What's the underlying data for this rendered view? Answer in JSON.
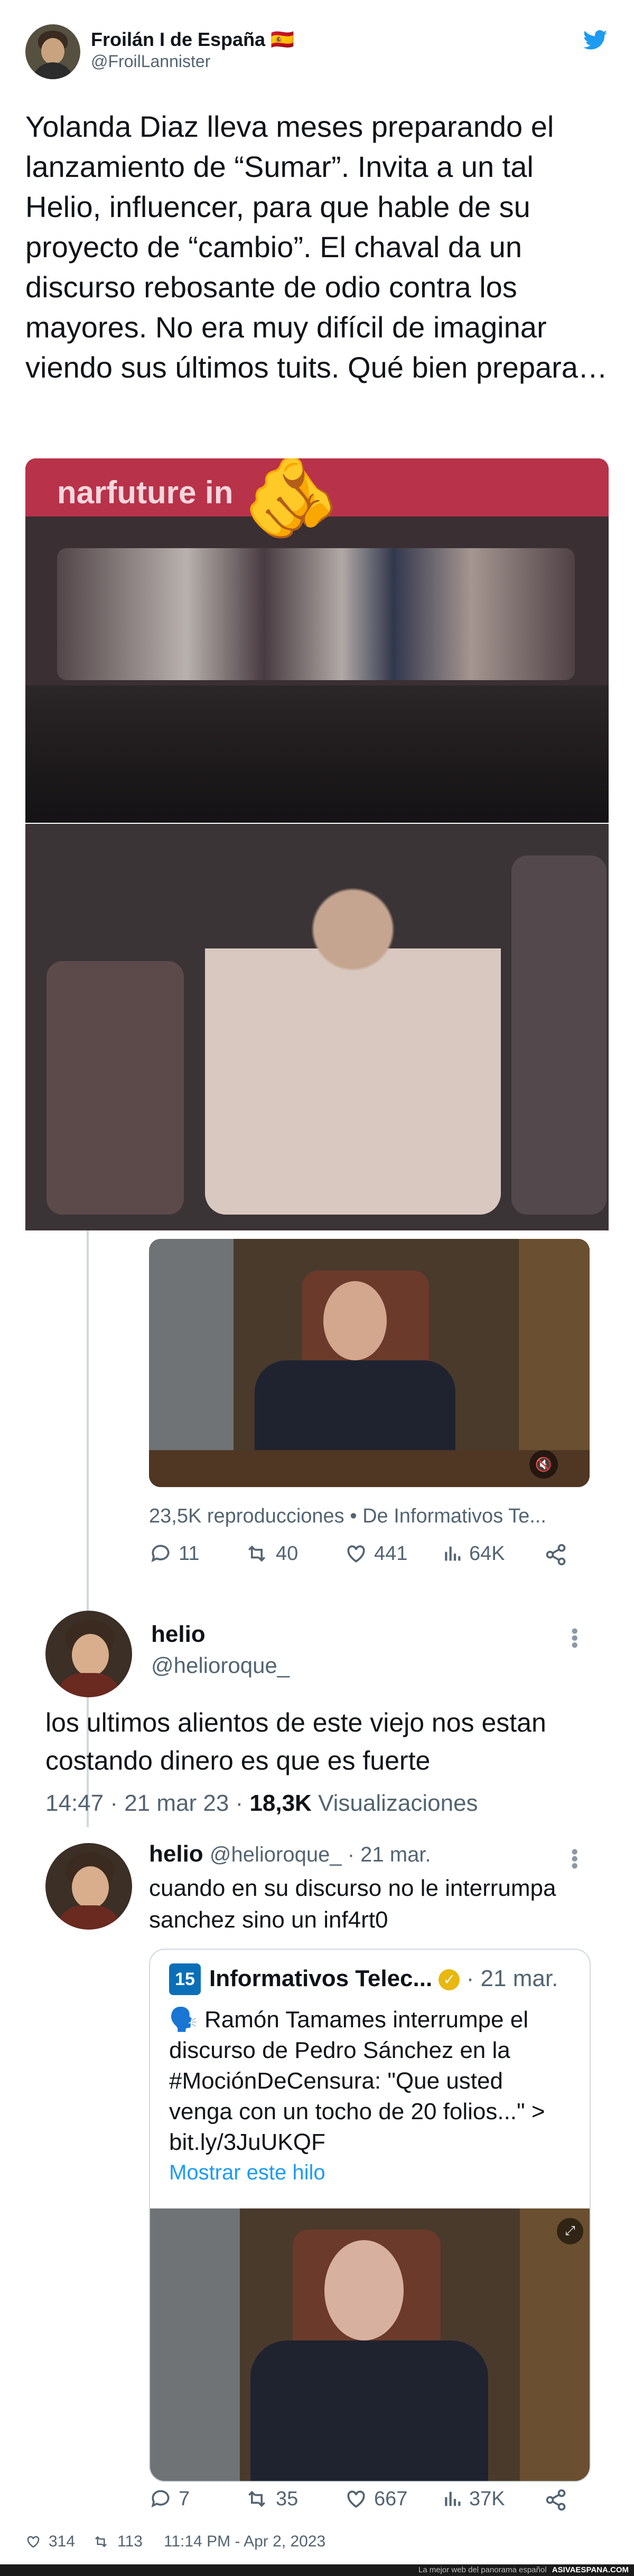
{
  "header": {
    "author_name": "Froilán I de España 🇪🇸",
    "author_handle": "@FroilLannister",
    "text": "Yolanda Diaz lleva meses preparando el lanzamiento de “Sumar”. Invita a un tal Helio, influencer, para que hable de su proyecto de “cambio”. El chaval da un discurso rebosante de odio contra los mayores. No era muy difícil de imaginar viendo sus últimos tuits. Qué bien prepara…"
  },
  "photo_top": {
    "emoji": "🫵",
    "banner_text": "narfuture in"
  },
  "embedded_video_tweet": {
    "views_line": "23,5K reproducciones • De Informativos Te...",
    "replies": "11",
    "retweets": "40",
    "likes": "441",
    "views": "64K"
  },
  "helio_tweet": {
    "name": "helio",
    "handle": "@helioroque_",
    "text": "los ultimos alientos de este viejo nos estan costando dinero es que es fuerte",
    "time": "14:47 · 21 mar 23 · ",
    "views_count": "18,3K",
    "views_label": " Visualizaciones"
  },
  "helio_reply": {
    "name": "helio",
    "handle": "@helioroque_ · 21 mar.",
    "text": "cuando en su discurso no le interrumpa sanchez sino un inf4rt0",
    "quoted": {
      "name": "Informativos Telec...",
      "date": "· 21 mar.",
      "text": "🗣️ Ramón Tamames interrumpe el discurso de Pedro Sánchez en la #MociónDeCensura: \"Que usted venga con un tocho de 20 folios...\" > bit.ly/3JuUKQF",
      "show_thread": "Mostrar este hilo"
    },
    "replies": "7",
    "retweets": "35",
    "likes": "667",
    "views": "37K"
  },
  "bottom_meta": {
    "likes": "314",
    "retweets": "113",
    "timestamp": "11:14 PM - Apr 2, 2023"
  },
  "footer": {
    "left": "La mejor web del panorama español",
    "right": "ASIVAESPANA.COM"
  },
  "colors": {
    "twitter_blue": "#1d9bf0",
    "text_primary": "#0f1419",
    "text_secondary": "#536471",
    "border": "#cfd9de"
  }
}
